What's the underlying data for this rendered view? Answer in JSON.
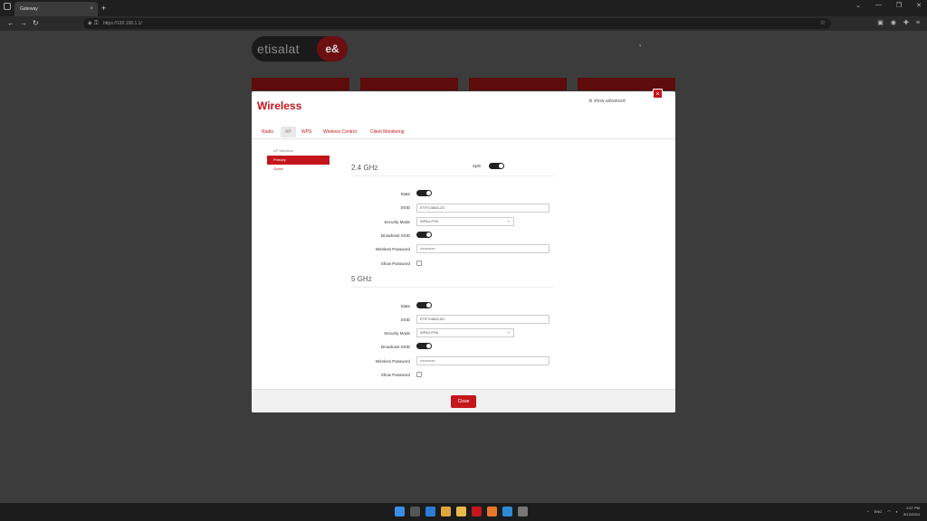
{
  "browser": {
    "tab_title": "Gateway",
    "tab_close": "×",
    "new_tab": "+",
    "url": "https://192.168.1.1/",
    "window_controls": [
      "⌄",
      "—",
      "❐",
      "✕"
    ]
  },
  "router": {
    "logo_text": "etisalat",
    "logo_badge": "e&",
    "menu_tabs": [
      "",
      "",
      "",
      ""
    ]
  },
  "modal": {
    "title": "Wireless",
    "show_advanced": "show advanced",
    "close_icon": "×",
    "tabs": [
      "Radio",
      "AP",
      "WPS",
      "Wireless Control",
      "Client Monitoring"
    ],
    "active_tab": "AP",
    "sidebar": {
      "heading": "AP Wireless",
      "items": [
        "Primary",
        "Guest"
      ],
      "active": "Primary"
    },
    "split_label": "Split",
    "band_24": {
      "title": "2.4 GHz",
      "state_label": "State",
      "ssid_label": "SSID",
      "ssid_value": "ETIFG3883-2G",
      "security_label": "Security Mode",
      "security_value": "WPA2-PSK",
      "broadcast_label": "Broadcast SSID",
      "password_label": "Wireless Password",
      "password_value": "••••••••••••",
      "show_password_label": "Show Password"
    },
    "band_5": {
      "title": "5 GHz",
      "state_label": "State",
      "ssid_label": "SSID",
      "ssid_value": "ETIFG3883-5G",
      "security_label": "Security Mode",
      "security_value": "WPA2-PSK",
      "broadcast_label": "Broadcast SSID",
      "password_label": "Wireless Password",
      "password_value": "••••••••••••",
      "show_password_label": "Show Password"
    },
    "close_button": "Close"
  },
  "taskbar": {
    "lang": "ENG",
    "time": "2:57 PM",
    "date": "8/12/2024"
  },
  "colors": {
    "accent": "#c4161c",
    "modal_bg": "#ffffff",
    "backdrop": "#3c3c3c"
  }
}
